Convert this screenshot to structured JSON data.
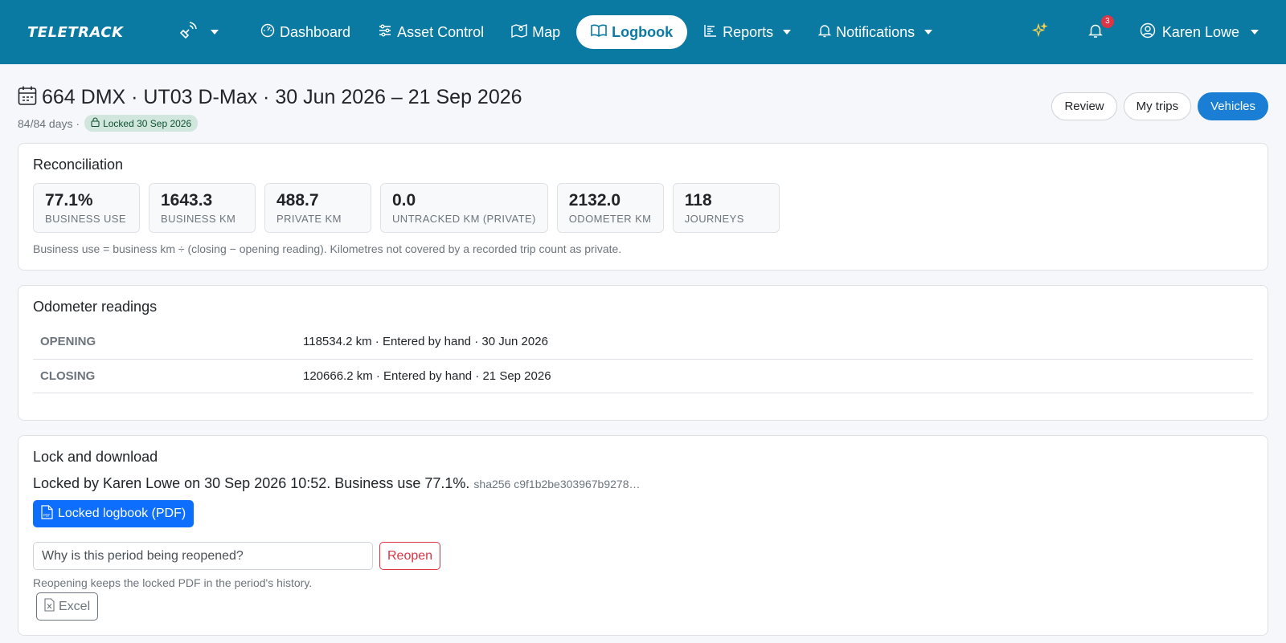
{
  "navbar": {
    "brand": "TELETRACK",
    "items": [
      {
        "label": "Dashboard"
      },
      {
        "label": "Asset Control"
      },
      {
        "label": "Map"
      },
      {
        "label": "Logbook"
      },
      {
        "label": "Reports"
      },
      {
        "label": "Notifications"
      }
    ],
    "notification_count": "3",
    "user_name": "Karen Lowe"
  },
  "header": {
    "title": "664 DMX · UT03 D-Max · 30 Jun 2026 – 21 Sep 2026",
    "days": "84/84 days ·",
    "locked_badge": "Locked 30 Sep 2026",
    "buttons": [
      "Review",
      "My trips",
      "Vehicles"
    ]
  },
  "reconciliation": {
    "heading": "Reconciliation",
    "stats": [
      {
        "value": "77.1%",
        "label": "Business use"
      },
      {
        "value": "1643.3",
        "label": "Business km"
      },
      {
        "value": "488.7",
        "label": "Private km"
      },
      {
        "value": "0.0",
        "label": "Untracked km (private)"
      },
      {
        "value": "2132.0",
        "label": "Odometer km"
      },
      {
        "value": "118",
        "label": "Journeys"
      }
    ],
    "note": "Business use = business km ÷ (closing − opening reading). Kilometres not covered by a recorded trip count as private."
  },
  "odometer": {
    "heading": "Odometer readings",
    "rows": [
      {
        "label": "OPENING",
        "value": "118534.2 km · Entered by hand · 30 Jun 2026"
      },
      {
        "label": "CLOSING",
        "value": "120666.2 km · Entered by hand · 21 Sep 2026"
      }
    ]
  },
  "lock": {
    "heading": "Lock and download",
    "locked_text": "Locked by Karen Lowe on 30 Sep 2026 10:52. Business use 77.1%.",
    "hash": "sha256 c9f1b2be303967b9278…",
    "pdf_label": "Locked logbook (PDF)",
    "reason_placeholder": "Why is this period being reopened?",
    "reopen_label": "Reopen",
    "reopen_note": "Reopening keeps the locked PDF in the period's history.",
    "excel_label": "Excel"
  }
}
